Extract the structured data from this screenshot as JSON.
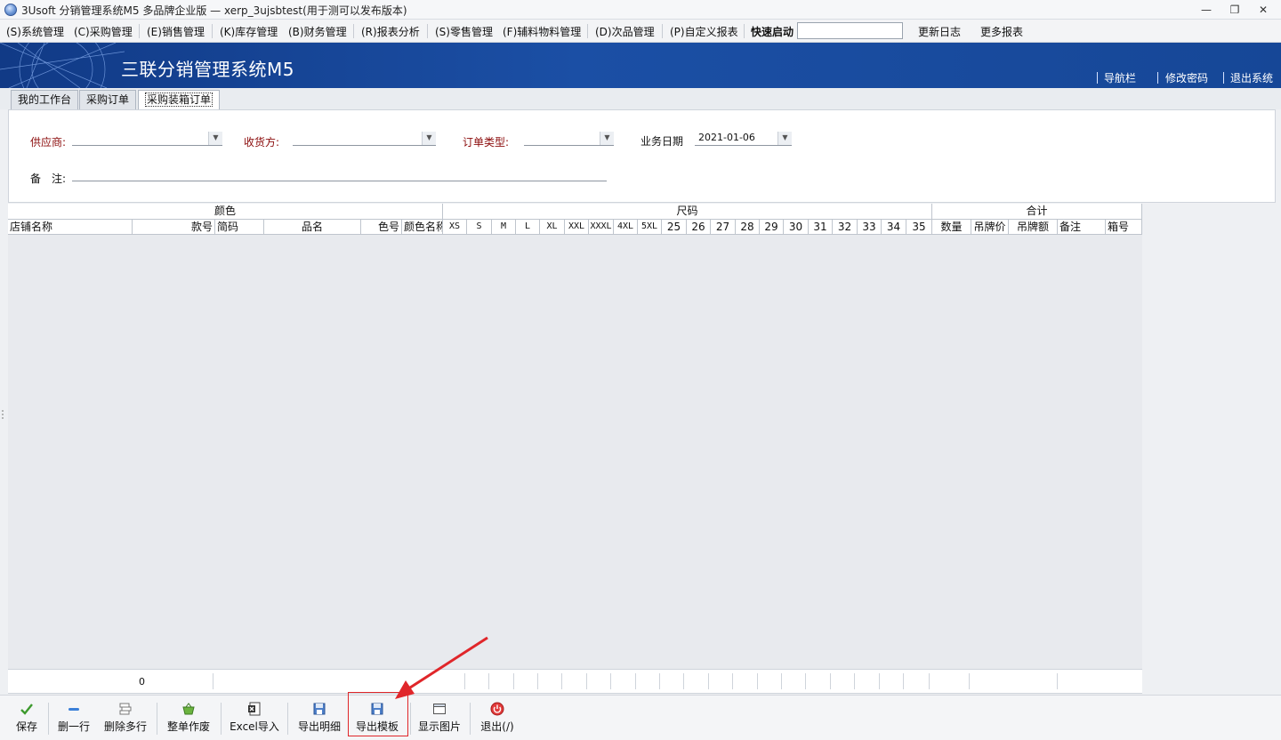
{
  "window": {
    "title": "3Usoft 分销管理系统M5 多品牌企业版 — xerp_3ujsbtest(用于测可以发布版本)",
    "minimize": "—",
    "restore": "❐",
    "close": "✕"
  },
  "menu": {
    "items": [
      "(S)系统管理",
      "(C)采购管理",
      "(E)销售管理",
      "(K)库存管理",
      "(B)财务管理",
      "(R)报表分析",
      "(S)零售管理",
      "(F)辅料物料管理",
      "(D)次品管理",
      "(P)自定义报表"
    ],
    "quick_label": "快速启动",
    "quick_value": "",
    "update_log": "更新日志",
    "more_reports": "更多报表"
  },
  "banner": {
    "brand": "三联分销管理系统M5",
    "links": [
      "导航栏",
      "修改密码",
      "退出系统"
    ]
  },
  "tabs": [
    {
      "label": "我的工作台",
      "active": false
    },
    {
      "label": "采购订单",
      "active": false
    },
    {
      "label": "采购装箱订单",
      "active": true
    }
  ],
  "form": {
    "supplier_label": "供应商:",
    "supplier_value": "",
    "receiver_label": "收货方:",
    "receiver_value": "",
    "order_type_label": "订单类型:",
    "order_type_value": "",
    "biz_date_label": "业务日期",
    "biz_date_value": "2021-01-06",
    "remark_label": "备　注:",
    "remark_value": ""
  },
  "grid": {
    "group_headers": [
      "颜色",
      "尺码",
      "合计"
    ],
    "columns": [
      "店铺名称",
      "款号",
      "简码",
      "品名",
      "色号",
      "颜色名称",
      "XS",
      "S",
      "M",
      "L",
      "XL",
      "XXL",
      "XXXL",
      "4XL",
      "5XL",
      "25",
      "26",
      "27",
      "28",
      "29",
      "30",
      "31",
      "32",
      "33",
      "34",
      "35",
      "数量",
      "吊牌价",
      "吊牌额",
      "备注",
      "箱号"
    ],
    "rows": [],
    "footer_total": "0"
  },
  "toolbar": {
    "buttons": [
      "保存",
      "删一行",
      "删除多行",
      "整单作废",
      "Excel导入",
      "导出明细",
      "导出模板",
      "显示图片",
      "退出(/)"
    ],
    "highlighted": "导出模板"
  },
  "colors": {
    "banner": "#1b4fa5",
    "required_label": "#8b0b0b",
    "highlight": "#e0262a"
  }
}
